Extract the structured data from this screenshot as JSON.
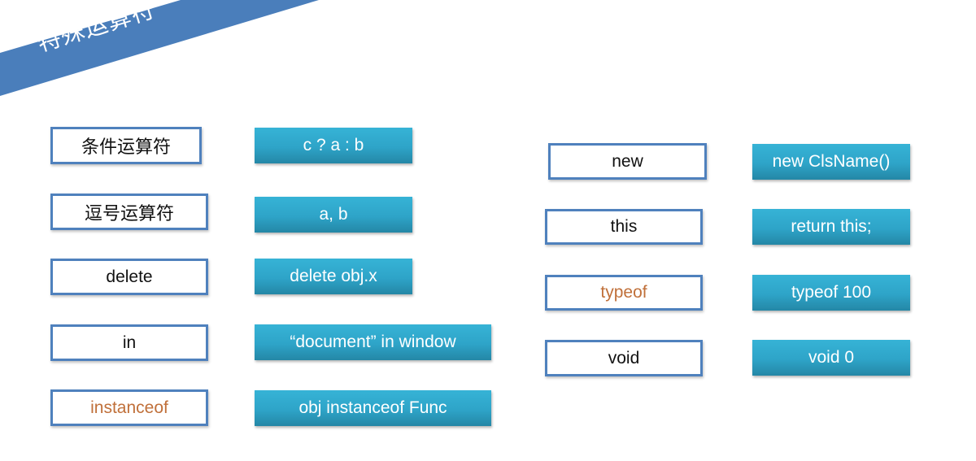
{
  "slide": {
    "title": "特殊运算符",
    "colors": {
      "ribbon": "#4a7ebb",
      "keyword_border": "#4f81bd",
      "example_fill": "#2ea4c8",
      "accent_text": "#c0703a"
    }
  },
  "left_column": [
    {
      "keyword": "条件运算符",
      "example": "c ? a : b",
      "highlight": false
    },
    {
      "keyword": "逗号运算符",
      "example": "a, b",
      "highlight": false
    },
    {
      "keyword": "delete",
      "example": "delete obj.x",
      "highlight": false
    },
    {
      "keyword": "in",
      "example": "“document” in window",
      "highlight": false
    },
    {
      "keyword": "instanceof",
      "example": "obj instanceof Func",
      "highlight": true
    }
  ],
  "right_column": [
    {
      "keyword": "new",
      "example": "new ClsName()",
      "highlight": false
    },
    {
      "keyword": "this",
      "example": "return this;",
      "highlight": false
    },
    {
      "keyword": "typeof",
      "example": "typeof 100",
      "highlight": true
    },
    {
      "keyword": "void",
      "example": "void 0",
      "highlight": false
    }
  ]
}
